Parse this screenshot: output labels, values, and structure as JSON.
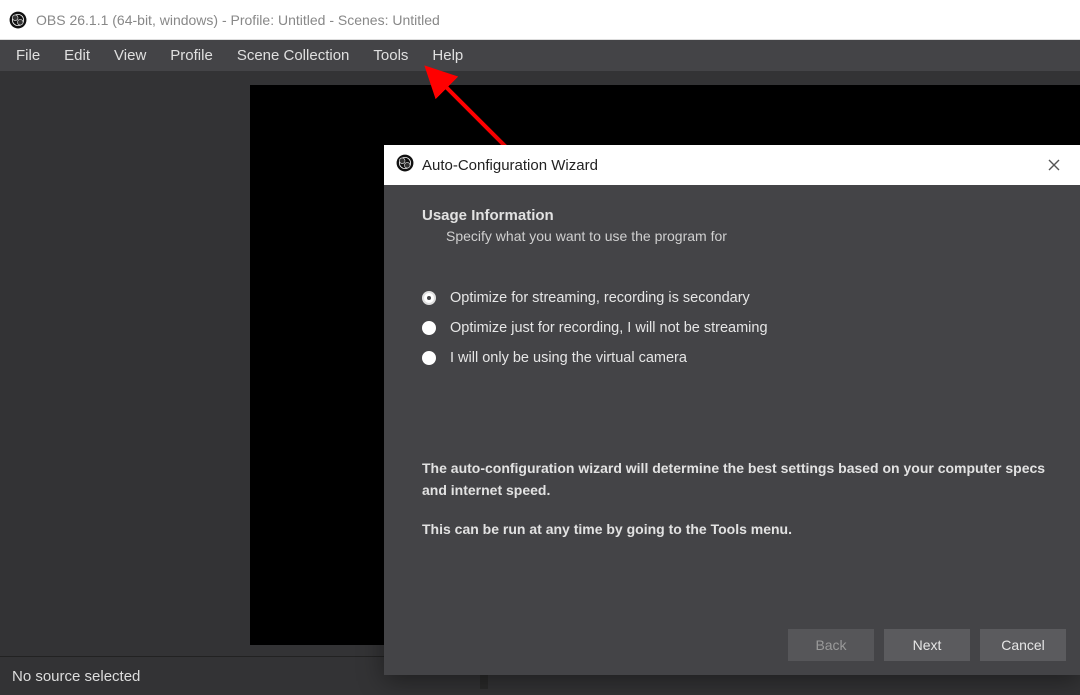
{
  "titlebar": "OBS 26.1.1 (64-bit, windows) - Profile: Untitled - Scenes: Untitled",
  "menu": [
    "File",
    "Edit",
    "View",
    "Profile",
    "Scene Collection",
    "Tools",
    "Help"
  ],
  "wizard": {
    "title": "Auto-Configuration Wizard",
    "heading": "Usage Information",
    "sub": "Specify what you want to use the program for",
    "options": [
      {
        "label": "Optimize for streaming, recording is secondary",
        "selected": true
      },
      {
        "label": "Optimize just for recording, I will not be streaming",
        "selected": false
      },
      {
        "label": "I will only be using the virtual camera",
        "selected": false
      }
    ],
    "desc1": "The auto-configuration wizard will determine the best settings based on your computer specs and internet speed.",
    "desc2": "This can be run at any time by going to the Tools menu.",
    "buttons": {
      "back": "Back",
      "next": "Next",
      "cancel": "Cancel"
    }
  },
  "status": "No source selected"
}
